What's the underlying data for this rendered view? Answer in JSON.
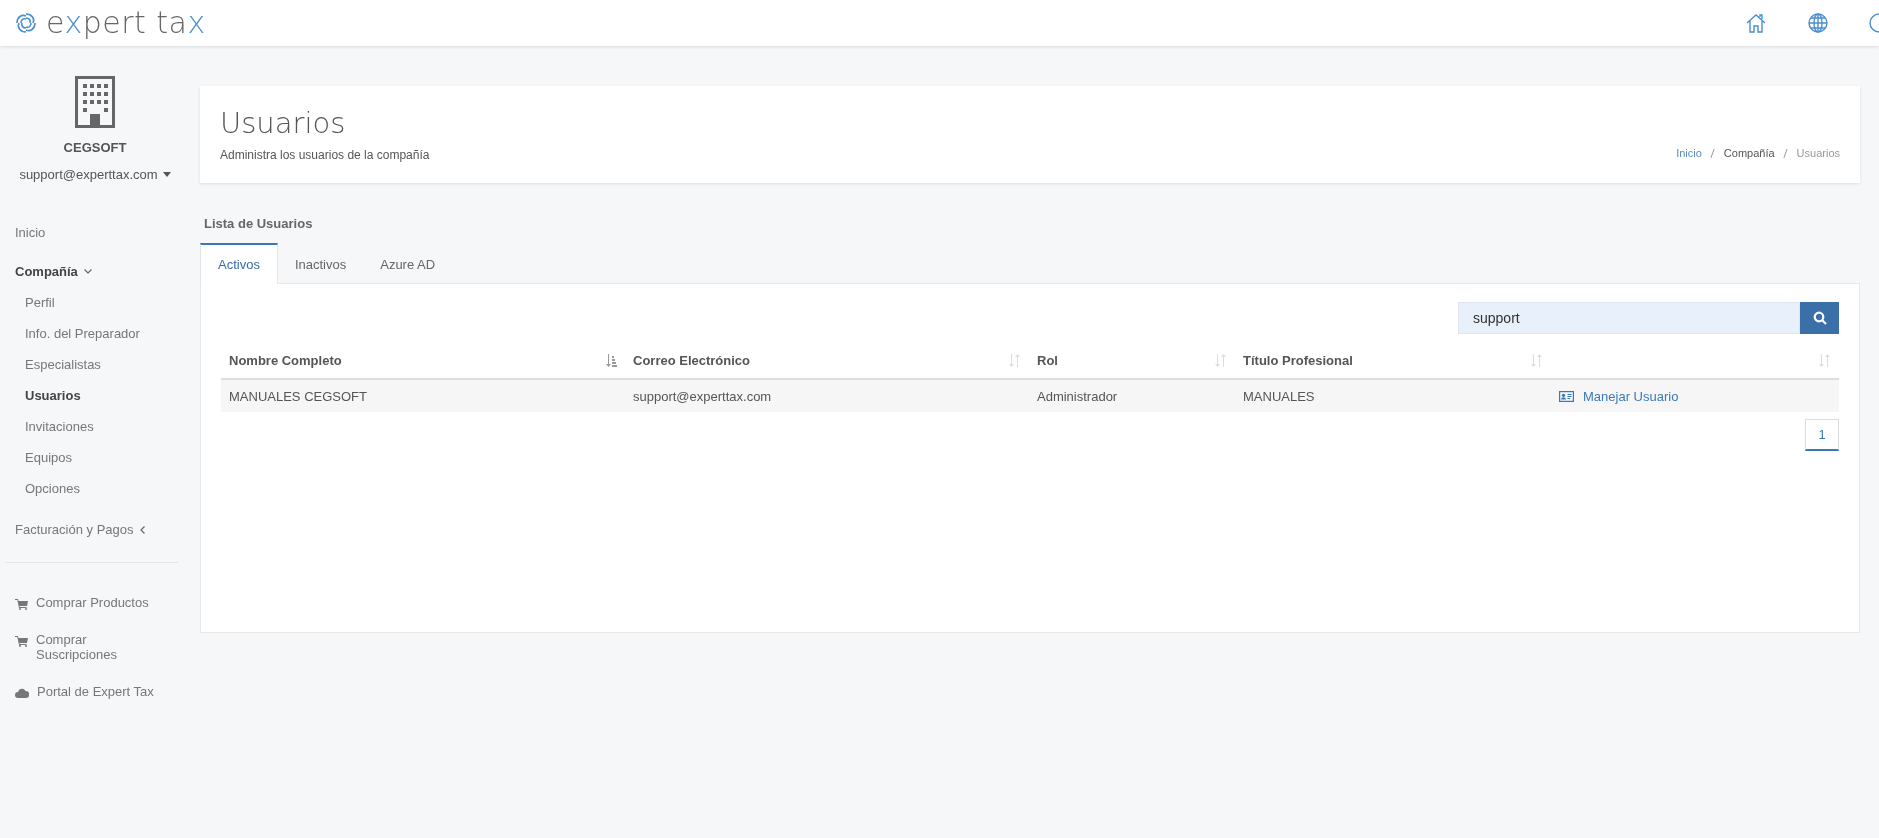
{
  "header": {
    "logo": [
      {
        "text": "e",
        "accent": false
      },
      {
        "text": "x",
        "accent": true
      },
      {
        "text": "pert ta",
        "accent": false
      },
      {
        "text": "x",
        "accent": true
      }
    ]
  },
  "sidebar": {
    "company": "CEGSOFT",
    "account": "support@experttax.com",
    "nav": [
      {
        "label": "Inicio",
        "kind": "link"
      },
      {
        "label": "Compañía",
        "kind": "group",
        "expanded": true,
        "children": [
          {
            "label": "Perfil",
            "selected": false
          },
          {
            "label": "Info. del Preparador",
            "selected": false
          },
          {
            "label": "Especialistas",
            "selected": false
          },
          {
            "label": "Usuarios",
            "selected": true
          },
          {
            "label": "Invitaciones",
            "selected": false
          },
          {
            "label": "Equipos",
            "selected": false
          },
          {
            "label": "Opciones",
            "selected": false
          }
        ]
      },
      {
        "label": "Facturación y Pagos",
        "kind": "group",
        "expanded": false
      }
    ],
    "shop_links": [
      {
        "label": "Comprar Productos",
        "kind": "cart"
      },
      {
        "label": "Comprar Suscripciones",
        "kind": "cart"
      },
      {
        "label": "Portal de Expert Tax",
        "kind": "cloud"
      }
    ]
  },
  "page_header": {
    "title": "Usuarios",
    "subtitle": "Administra los usuarios de la compañía",
    "breadcrumb": [
      {
        "label": "Inicio",
        "kind": "link"
      },
      {
        "label": "Compañía",
        "kind": "item"
      },
      {
        "label": "Usuarios",
        "kind": "current"
      }
    ]
  },
  "users": {
    "title": "Lista de Usuarios",
    "tabs": [
      {
        "label": "Activos",
        "selected": true
      },
      {
        "label": "Inactivos",
        "selected": false
      },
      {
        "label": "Azure AD",
        "selected": false
      }
    ],
    "search": {
      "value": "support"
    },
    "table": {
      "columns": [
        {
          "label": "Nombre Completo",
          "sorted": true
        },
        {
          "label": "Correo Electrónico",
          "sorted": false
        },
        {
          "label": "Rol",
          "sorted": false
        },
        {
          "label": "Título Profesional",
          "sorted": false
        },
        {
          "sorted": false
        }
      ],
      "rows": [
        {
          "cells": [
            "MANUALES CEGSOFT",
            "support@experttax.com",
            "Administrador",
            "MANUALES"
          ],
          "action": "Manejar Usuario"
        }
      ]
    },
    "pagination": [
      {
        "label": "1",
        "selected": true
      }
    ]
  }
}
